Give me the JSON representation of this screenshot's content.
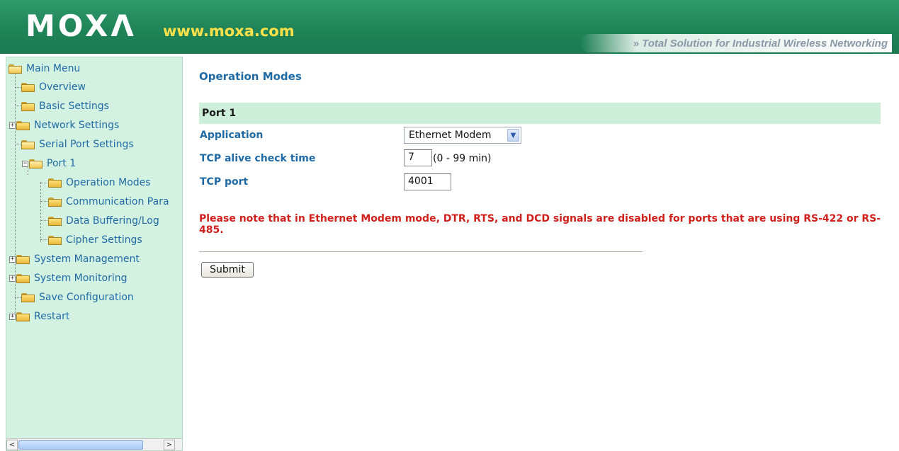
{
  "header": {
    "logo": "MOXΛ",
    "url": "www.moxa.com",
    "tagline_chevron": "»",
    "tagline": "Total Solution for Industrial Wireless Networking",
    "colors": {
      "header_green": "#1f8458",
      "url_yellow": "#ffe14a"
    }
  },
  "sidebar": {
    "items": [
      {
        "label": "Main Menu",
        "icon": "folder-open-icon"
      },
      {
        "label": "Overview",
        "icon": "folder-icon"
      },
      {
        "label": "Basic Settings",
        "icon": "folder-icon"
      },
      {
        "label": "Network Settings",
        "icon": "folder-icon",
        "expander": "+"
      },
      {
        "label": "Serial Port Settings",
        "icon": "folder-open-icon"
      },
      {
        "label": "Port 1",
        "icon": "folder-open-icon",
        "expander": "−"
      },
      {
        "label": "Operation Modes",
        "icon": "folder-icon"
      },
      {
        "label": "Communication Para",
        "icon": "folder-icon"
      },
      {
        "label": "Data Buffering/Log",
        "icon": "folder-icon"
      },
      {
        "label": "Cipher Settings",
        "icon": "folder-icon"
      },
      {
        "label": "System Management",
        "icon": "folder-icon",
        "expander": "+"
      },
      {
        "label": "System Monitoring",
        "icon": "folder-icon",
        "expander": "+"
      },
      {
        "label": "Save Configuration",
        "icon": "folder-icon"
      },
      {
        "label": "Restart",
        "icon": "folder-icon",
        "expander": "+"
      }
    ],
    "scroll_left": "<",
    "scroll_right": ">"
  },
  "main": {
    "title": "Operation Modes",
    "section": "Port 1",
    "fields": {
      "application_label": "Application",
      "application_value": "Ethernet Modem",
      "tcp_alive_label": "TCP alive check time",
      "tcp_alive_value": "7",
      "tcp_alive_hint": "(0 - 99 min)",
      "tcp_port_label": "TCP port",
      "tcp_port_value": "4001"
    },
    "warning": "Please note that in Ethernet Modem mode, DTR, RTS, and DCD signals are disabled for ports that are using RS-422 or RS-485.",
    "submit_label": "Submit",
    "colors": {
      "label_blue": "#1f6aa5",
      "warning_red": "#d0201b",
      "section_bg": "#cdeed9",
      "sidebar_bg": "#d4f2e1"
    }
  }
}
